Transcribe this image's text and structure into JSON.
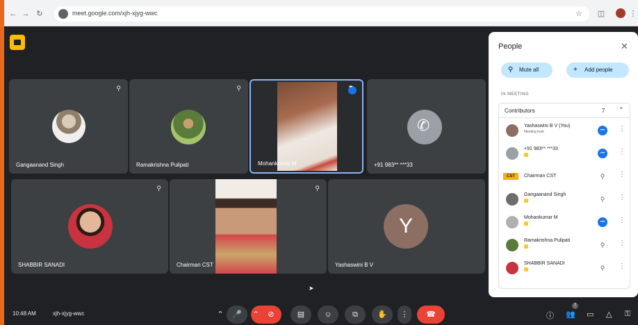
{
  "browser": {
    "url": "meet.google.com/xjh-xjyg-wwc",
    "icons": [
      "back-icon",
      "forward-icon",
      "reload-icon",
      "star-icon",
      "extensions-icon",
      "profile-avatar",
      "menu-icon"
    ]
  },
  "tiles": [
    {
      "name": "Gangaanand Singh",
      "muted": true
    },
    {
      "name": "Ramakrishna Pulipati",
      "muted": true
    },
    {
      "name": "Mohankumar M",
      "speaking": true
    },
    {
      "name": "+91 983** ***33",
      "icon": "phone-icon"
    },
    {
      "name": "SHABBIR SANADI",
      "muted": true
    },
    {
      "name": "Chairman CST",
      "muted": true
    },
    {
      "name": "Yashaswini B V",
      "initial": "Y",
      "color": "#8d6e63"
    }
  ],
  "panel": {
    "title": "People",
    "mute_all": "Mute all",
    "add_people": "Add people",
    "in_meeting": "IN MEETING",
    "contributors_label": "Contributors",
    "contributors_count": "7",
    "participants": [
      {
        "name": "Yashaswini B V (You)",
        "sub": "Meeting host",
        "mic": "speaking",
        "avatar_color": "#8d6e63"
      },
      {
        "name": "+91 983** ***33",
        "mic": "speaking",
        "host_badge": true,
        "avatar_color": "#9aa0a6"
      },
      {
        "name": "Chairman CST",
        "mic": "off",
        "logo": "CST"
      },
      {
        "name": "Gangaanand Singh",
        "mic": "off",
        "host_badge": true,
        "avatar_color": "#6d6d6d"
      },
      {
        "name": "Mohankumar M",
        "mic": "speaking",
        "host_badge": true,
        "avatar_color": "#b0b0b0"
      },
      {
        "name": "Ramakrishna Pulipati",
        "mic": "off",
        "host_badge": true,
        "avatar_color": "#5b7b3a"
      },
      {
        "name": "SHABBIR SANADI",
        "mic": "off",
        "host_badge": true,
        "avatar_color": "#c9333f"
      }
    ]
  },
  "bottom": {
    "time": "10:48 AM",
    "meeting_code": "xjh-xjyg-wwc",
    "people_count": "7",
    "colors": {
      "end_call": "#ea4335",
      "accent": "#1a73e8"
    }
  }
}
